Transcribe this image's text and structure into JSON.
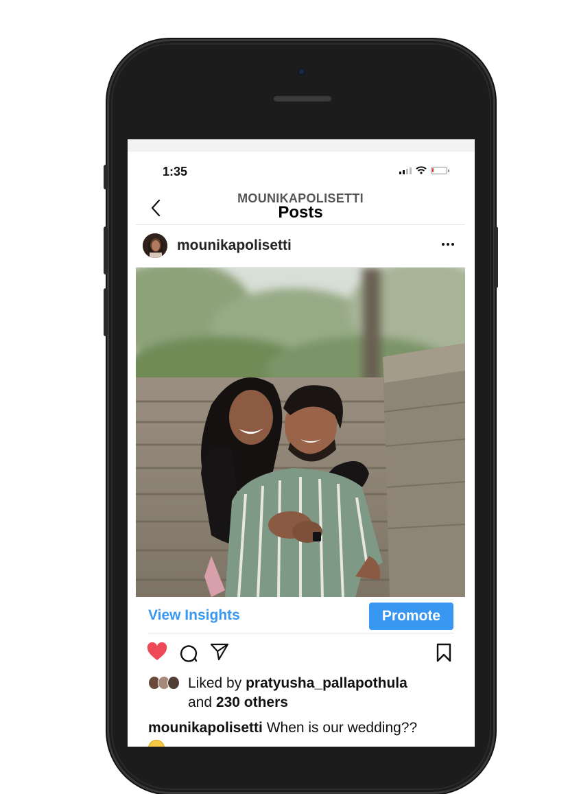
{
  "status_bar": {
    "time": "1:35",
    "battery_level": 0.12
  },
  "header": {
    "username": "MOUNIKAPOLISETTI",
    "title": "Posts"
  },
  "post": {
    "username": "mounikapolisetti",
    "view_insights": "View Insights",
    "promote": "Promote",
    "likes": {
      "prefix": "Liked by",
      "user": "pratyusha_pallapothula",
      "and_text": "and",
      "count_text": "230 others"
    },
    "caption": {
      "user": "mounikapolisetti",
      "text": "When is our wedding??"
    }
  },
  "icons": {
    "back": "back-chevron-icon",
    "more": "more-horizontal-icon",
    "like": "heart-filled-icon",
    "comment": "comment-icon",
    "share": "send-icon",
    "save": "bookmark-icon"
  },
  "colors": {
    "accent": "#3897f0",
    "like": "#ed4956",
    "text": "#111111"
  }
}
